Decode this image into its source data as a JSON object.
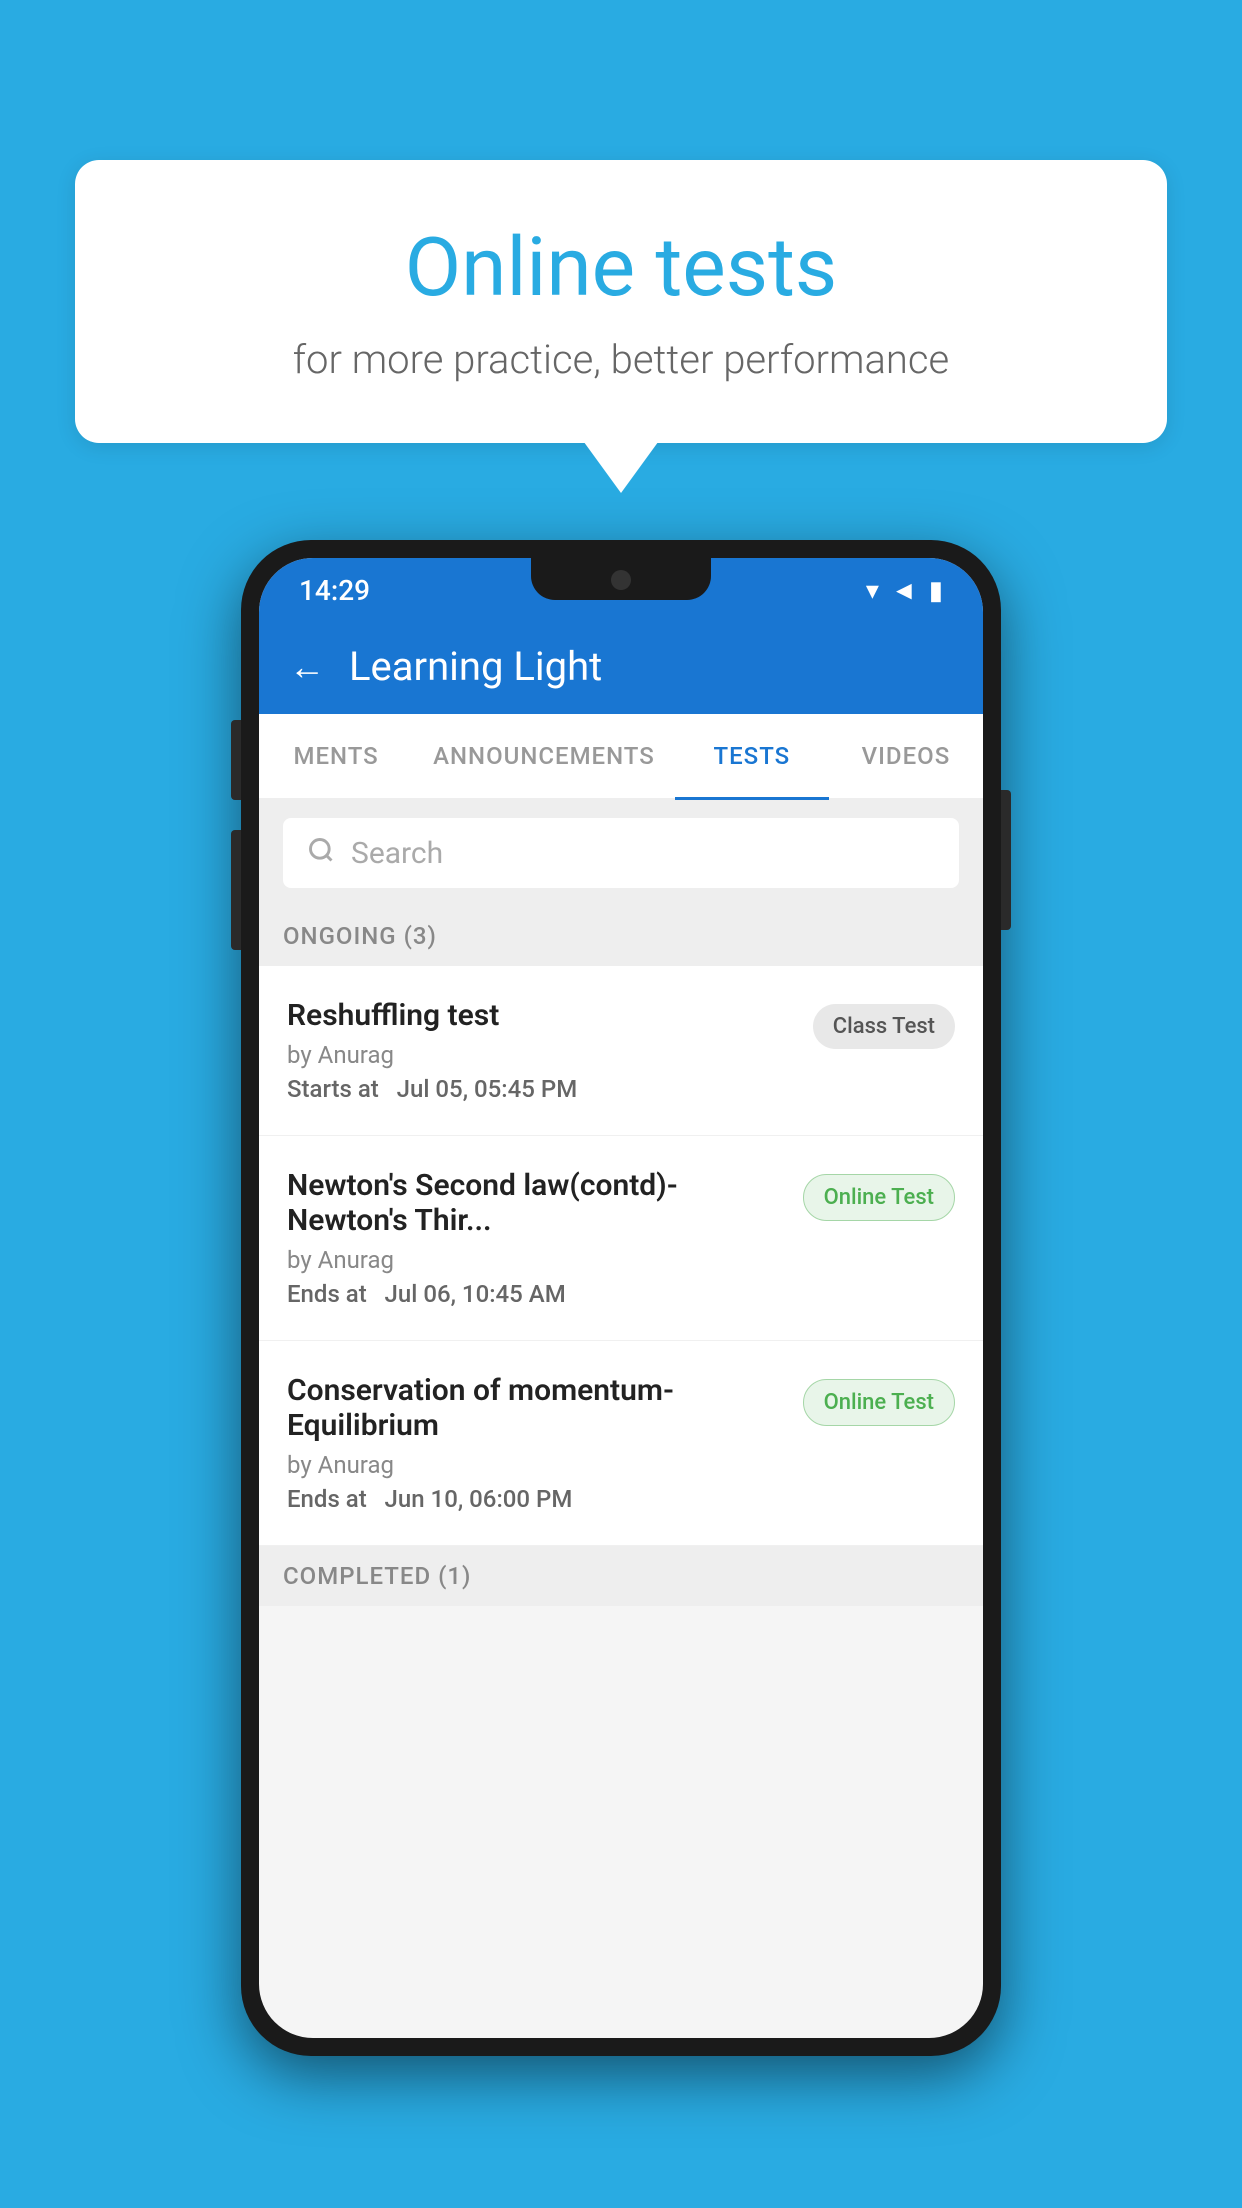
{
  "background": {
    "color": "#29ABE2"
  },
  "speech_bubble": {
    "title": "Online tests",
    "subtitle": "for more practice, better performance"
  },
  "phone": {
    "status_bar": {
      "time": "14:29",
      "wifi": "▾",
      "signal": "▲",
      "battery": "▮"
    },
    "header": {
      "back_label": "←",
      "title": "Learning Light"
    },
    "tabs": [
      {
        "label": "MENTS",
        "active": false
      },
      {
        "label": "ANNOUNCEMENTS",
        "active": false
      },
      {
        "label": "TESTS",
        "active": true
      },
      {
        "label": "VIDEOS",
        "active": false
      }
    ],
    "search": {
      "placeholder": "Search"
    },
    "ongoing_section": {
      "label": "ONGOING (3)"
    },
    "tests": [
      {
        "name": "Reshuffling test",
        "by": "by Anurag",
        "time_label": "Starts at",
        "time_value": "Jul 05, 05:45 PM",
        "badge": "Class Test",
        "badge_type": "class"
      },
      {
        "name": "Newton's Second law(contd)-Newton's Thir...",
        "by": "by Anurag",
        "time_label": "Ends at",
        "time_value": "Jul 06, 10:45 AM",
        "badge": "Online Test",
        "badge_type": "online"
      },
      {
        "name": "Conservation of momentum-Equilibrium",
        "by": "by Anurag",
        "time_label": "Ends at",
        "time_value": "Jun 10, 06:00 PM",
        "badge": "Online Test",
        "badge_type": "online"
      }
    ],
    "completed_section": {
      "label": "COMPLETED (1)"
    }
  }
}
